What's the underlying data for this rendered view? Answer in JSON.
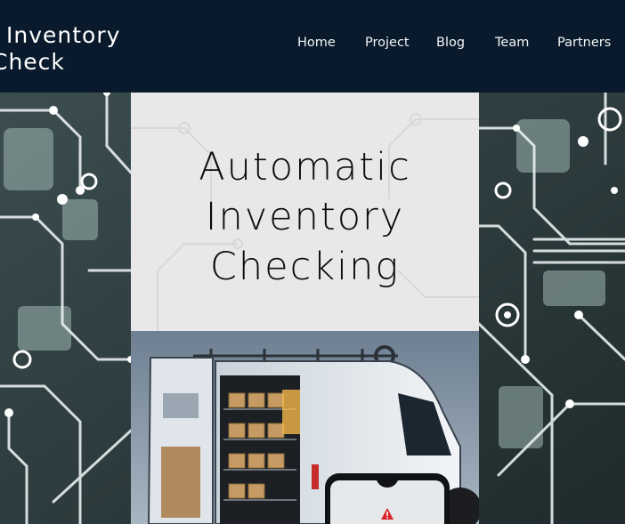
{
  "logo": {
    "line1": "Inventory",
    "line2": "Check"
  },
  "nav": {
    "items": [
      "Home",
      "Project",
      "Blog",
      "Team",
      "Partners"
    ]
  },
  "hero": {
    "title_lines": [
      "Automatic",
      "Inventory",
      "Checking"
    ]
  },
  "illustration": {
    "subject": "delivery van with shelves of boxes and a phone alert",
    "icon": "warning-icon"
  },
  "colors": {
    "header_bg": "#081a2c",
    "card_bg": "#e8e8e8",
    "circuit_bg": "#2e3d3f",
    "alert": "#d9232a"
  }
}
